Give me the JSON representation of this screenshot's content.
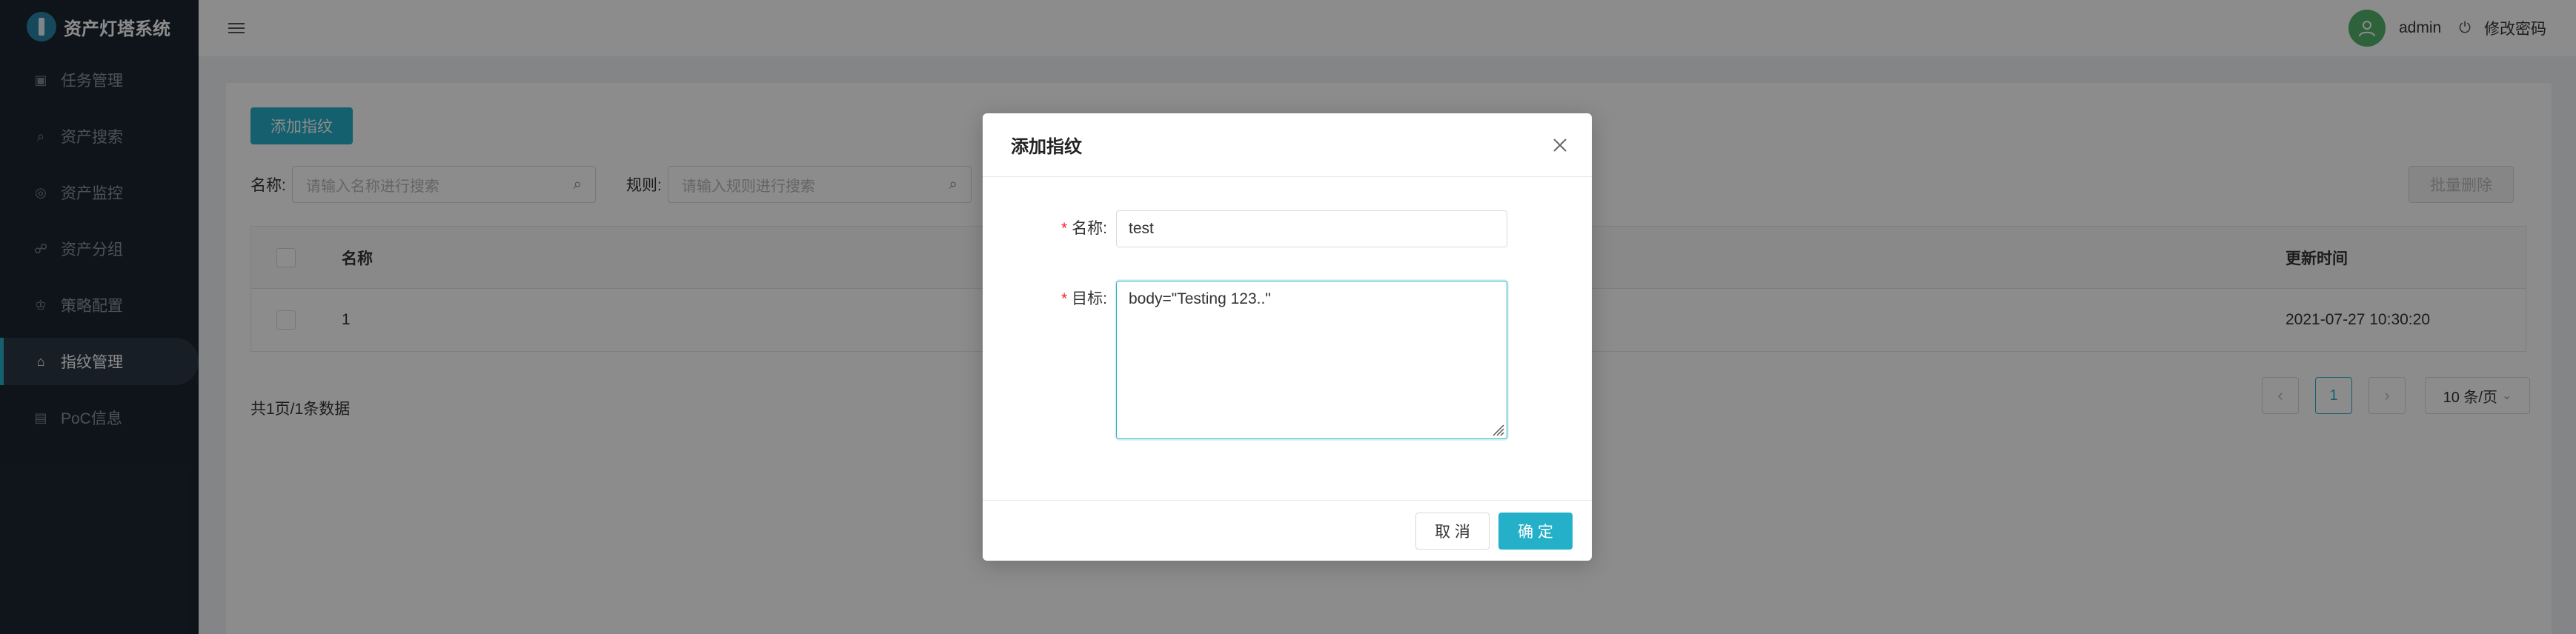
{
  "app": {
    "title": "资产灯塔系统"
  },
  "sidebar": {
    "items": [
      {
        "label": "任务管理",
        "icon": "calendar-icon"
      },
      {
        "label": "资产搜索",
        "icon": "search-icon"
      },
      {
        "label": "资产监控",
        "icon": "eye-icon"
      },
      {
        "label": "资产分组",
        "icon": "cluster-icon"
      },
      {
        "label": "策略配置",
        "icon": "crown-icon"
      },
      {
        "label": "指纹管理",
        "icon": "tag-icon",
        "active": true
      },
      {
        "label": "PoC信息",
        "icon": "code-icon"
      }
    ]
  },
  "header": {
    "username": "admin",
    "change_password": "修改密码"
  },
  "toolbar": {
    "add_label": "添加指纹",
    "batch_delete_label": "批量删除",
    "name_filter_label": "名称:",
    "name_filter_placeholder": "请输入名称进行搜索",
    "rule_filter_label": "规则:",
    "rule_filter_placeholder": "请输入规则进行搜索"
  },
  "table": {
    "columns": {
      "name": "名称",
      "updated": "更新时间"
    },
    "rows": [
      {
        "name": "1",
        "updated": "2021-07-27 10:30:20"
      }
    ]
  },
  "pagination": {
    "summary": "共1页/1条数据",
    "current_page": "1",
    "page_size": "10 条/页"
  },
  "modal": {
    "title": "添加指纹",
    "name_label": "名称:",
    "name_value": "test",
    "target_label": "目标:",
    "target_value": "body=\"Testing 123..\"",
    "cancel_label": "取 消",
    "ok_label": "确 定"
  },
  "colors": {
    "accent": "#25b0c9",
    "sidebar_bg": "#1c2632",
    "required": "#f5222d"
  }
}
